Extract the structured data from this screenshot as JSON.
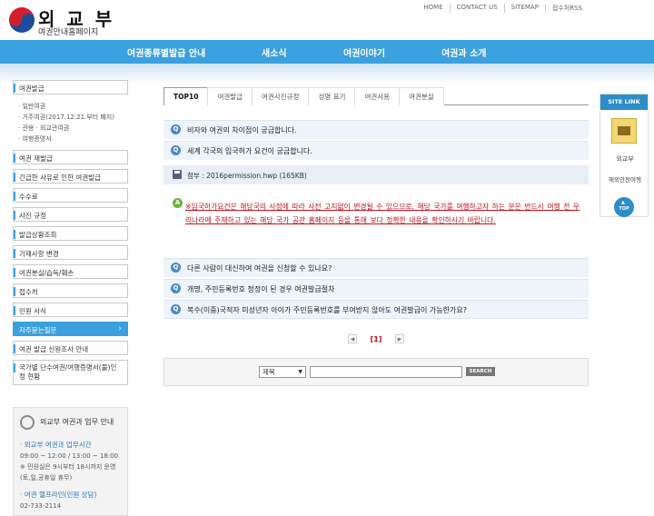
{
  "header": {
    "title": "외 교 부",
    "subtitle": "여권안내홈페이지",
    "utility_links": [
      "HOME",
      "CONTACT US",
      "SITEMAP",
      "접수처RSS"
    ]
  },
  "gnb": {
    "items": [
      "여권종류별발급 안내",
      "새소식",
      "여권이야기",
      "여권과 소개"
    ]
  },
  "lnb": {
    "items": [
      {
        "label": "여권발급"
      },
      {
        "label": "여권 재발급"
      },
      {
        "label": "긴급한 사유로 인한 여권발급"
      },
      {
        "label": "수수료"
      },
      {
        "label": "사진 규정"
      },
      {
        "label": "발급상황조회"
      },
      {
        "label": "기재사항 변경"
      },
      {
        "label": "여권분실/습득/훼손"
      },
      {
        "label": "접수처"
      },
      {
        "label": "민원 서식"
      },
      {
        "label": "자주묻는질문"
      },
      {
        "label": "여권 발급 신원조사 안내"
      },
      {
        "label": "국가별 단수여권/여행증명서(불)인정 현황"
      }
    ],
    "sub_items": [
      "· 일반여권",
      "· 거주여권(2017.12.21.부터 폐지)",
      "· 관용 · 외교관여권",
      "· 여행증명서"
    ]
  },
  "info": {
    "title": "외교부 여권과 업무 안내",
    "hours_title": "· 외교부 여권과 업무시간",
    "hours_lines": [
      "09:00 ~ 12:00 / 13:00 ~ 18:00",
      "※ 민원실은 9시부터 18시까지 운영",
      "(토,일,공휴일 휴무)"
    ],
    "helpline_title": "· 여권 헬프라인(민원 상담)",
    "helpline_number": "02-733-2114"
  },
  "tabs": [
    "TOP10",
    "여권발급",
    "여권사진규정",
    "성명 표기",
    "여권사용",
    "여권분실"
  ],
  "faq": {
    "q1": "비자와 여권의 차이점이 궁금합니다.",
    "q2": "세계 각국의 입국허가 요건이 궁금합니다.",
    "attachment": "첨부 : 2016permission.hwp (165KB)",
    "answer": "※입국허가요건은 해당국의 사정에 따라 사전 고지없이 변경될 수 있으므로, 해당 국가를 여행하고자 하는 분은 반드시 여행 전 우리나라에 주재하고 있는 해당 국가 공관 홈페이지 등을 통해 보다 정확한 내용을 확인하시기 바랍니다.",
    "q3": "다른 사람이 대신하여 여권을 신청할 수 있나요?",
    "q4": "개명, 주민등록번호 정정이 된 경우 여권발급절차",
    "q5": "복수(이중)국적자 미성년자 아이가 주민등록번호를 부여받지 않아도 여권발급이 가능한가요?"
  },
  "pager": {
    "current": "[1]"
  },
  "search": {
    "select_value": "제목",
    "button": "SEARCH"
  },
  "sitelink": {
    "title": "SITE LINK",
    "link1": "외교부",
    "link2": "해외안전여행",
    "top": "TOP"
  }
}
